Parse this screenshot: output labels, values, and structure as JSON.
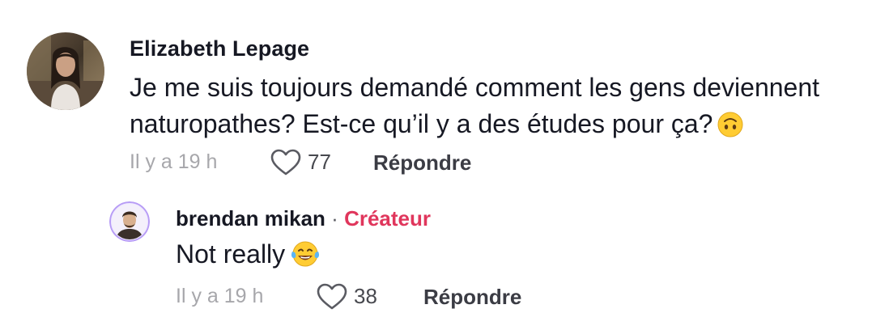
{
  "comment": {
    "author": "Elizabeth Lepage",
    "text": "Je me suis toujours demandé comment les gens deviennent naturopathes? Est-ce qu’il y a des études pour ça?",
    "emoji": "upside-down-face-emoji",
    "time": "Il y a 19 h",
    "likes": "77",
    "reply_label": "Répondre"
  },
  "reply": {
    "author": "brendan mikan",
    "separator": "·",
    "badge": "Créateur",
    "text": "Not really",
    "emoji": "face-with-tears-of-joy-emoji",
    "time": "Il y a 19 h",
    "likes": "38",
    "reply_label": "Répondre"
  },
  "colors": {
    "text": "#161823",
    "muted": "#a7a7ab",
    "creator_badge": "#e0365c",
    "avatar_ring": "#b79cf5"
  }
}
